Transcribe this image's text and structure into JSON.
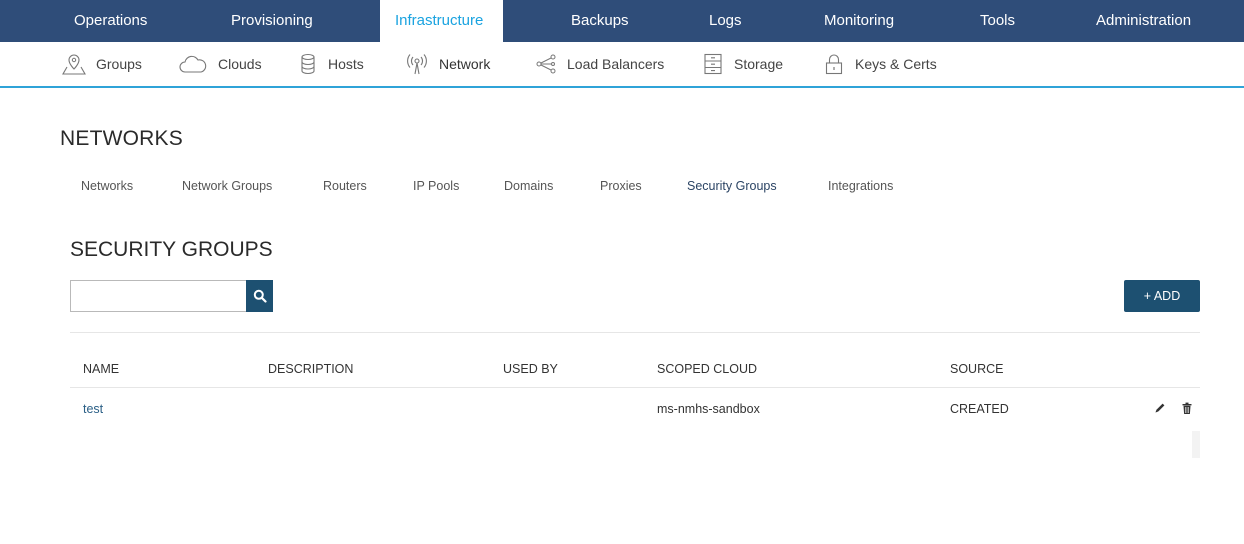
{
  "topnav": {
    "items": [
      {
        "label": "Operations"
      },
      {
        "label": "Provisioning"
      },
      {
        "label": "Infrastructure"
      },
      {
        "label": "Backups"
      },
      {
        "label": "Logs"
      },
      {
        "label": "Monitoring"
      },
      {
        "label": "Tools"
      },
      {
        "label": "Administration"
      }
    ],
    "active_index": 2,
    "background": "#2f4d79",
    "active_color": "#1aa3e0"
  },
  "subnav": {
    "items": [
      {
        "label": "Groups",
        "icon": "map-pin-icon"
      },
      {
        "label": "Clouds",
        "icon": "cloud-icon"
      },
      {
        "label": "Hosts",
        "icon": "database-icon"
      },
      {
        "label": "Network",
        "icon": "signal-tower-icon"
      },
      {
        "label": "Load Balancers",
        "icon": "share-network-icon"
      },
      {
        "label": "Storage",
        "icon": "storage-cabinet-icon"
      },
      {
        "label": "Keys & Certs",
        "icon": "lock-icon"
      }
    ],
    "active_index": 3,
    "underline_color": "#2fa3d8"
  },
  "page": {
    "title": "NETWORKS",
    "tabs": [
      {
        "label": "Networks"
      },
      {
        "label": "Network Groups"
      },
      {
        "label": "Routers"
      },
      {
        "label": "IP Pools"
      },
      {
        "label": "Domains"
      },
      {
        "label": "Proxies"
      },
      {
        "label": "Security Groups"
      },
      {
        "label": "Integrations"
      }
    ],
    "active_tab_index": 6
  },
  "section": {
    "title": "SECURITY GROUPS",
    "search": {
      "value": "",
      "placeholder": "",
      "icon": "search-icon"
    },
    "add_button": "+ ADD",
    "button_color": "#1d5071"
  },
  "table": {
    "columns": [
      "NAME",
      "DESCRIPTION",
      "USED BY",
      "SCOPED CLOUD",
      "SOURCE"
    ],
    "rows": [
      {
        "name": "test",
        "description": "",
        "used_by": "",
        "scoped_cloud": "ms-nmhs-sandbox",
        "source": "CREATED",
        "actions": [
          "pencil-icon",
          "trash-icon"
        ]
      }
    ]
  }
}
